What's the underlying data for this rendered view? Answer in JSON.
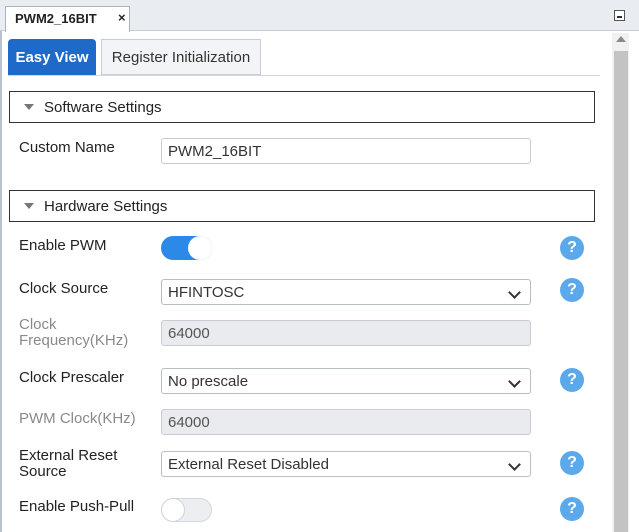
{
  "document_tab": {
    "title": "PWM2_16BIT",
    "close": "×"
  },
  "view_tabs": [
    {
      "label": "Easy View",
      "active": true
    },
    {
      "label": "Register Initialization",
      "active": false
    }
  ],
  "software_settings": {
    "header": "Software Settings",
    "custom_name": {
      "label": "Custom Name",
      "value": "PWM2_16BIT"
    }
  },
  "hardware_settings": {
    "header": "Hardware Settings",
    "enable_pwm": {
      "label": "Enable PWM",
      "enabled": true
    },
    "clock_source": {
      "label": "Clock Source",
      "value": "HFINTOSC"
    },
    "clock_frequency": {
      "label_line1": "Clock",
      "label_line2": "Frequency(KHz)",
      "value": "64000"
    },
    "clock_prescaler": {
      "label": "Clock Prescaler",
      "value": "No prescale"
    },
    "pwm_clock": {
      "label": "PWM Clock(KHz)",
      "value": "64000"
    },
    "external_reset_source": {
      "label_line1": "External Reset",
      "label_line2": "Source",
      "value": "External Reset Disabled"
    },
    "enable_push_pull": {
      "label": "Enable Push-Pull",
      "enabled": false
    }
  },
  "help_icon_glyph": "?",
  "colors": {
    "accent": "#1f6ac9",
    "toggle_on": "#2b8ae8",
    "help": "#5ba9ea"
  }
}
